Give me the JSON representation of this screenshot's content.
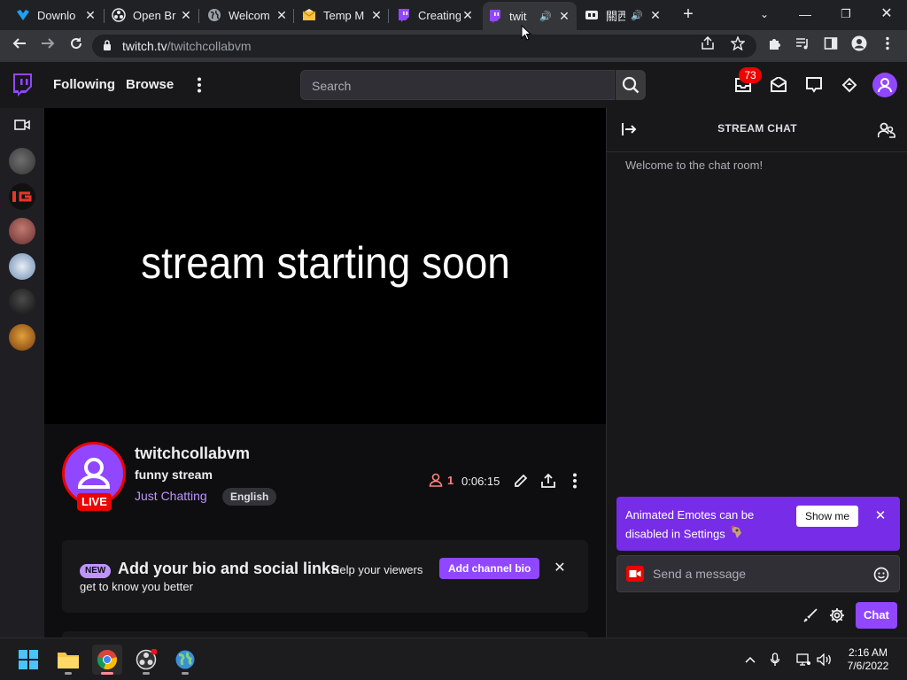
{
  "browser": {
    "tabs": [
      {
        "title": "Downlo",
        "icon": "blue-bird-icon"
      },
      {
        "title": "Open Br",
        "icon": "open-broadcaster-icon"
      },
      {
        "title": "Welcom",
        "icon": "globe-icon"
      },
      {
        "title": "Temp M",
        "icon": "envelope-icon"
      },
      {
        "title": "Creating",
        "icon": "twitch-icon"
      },
      {
        "title": "twit",
        "icon": "twitch-icon"
      },
      {
        "title": "關西",
        "icon": "media-icon"
      }
    ],
    "address": {
      "host": "twitch.tv",
      "path": "/twitchcollabvm"
    }
  },
  "twitch": {
    "nav": {
      "following": "Following",
      "browse": "Browse",
      "search_placeholder": "Search",
      "notification_count": "73"
    },
    "channel": {
      "name": "twitchcollabvm",
      "stream_title": "funny stream",
      "category": "Just Chatting",
      "language_tag": "English",
      "live_label": "LIVE",
      "viewer_count": "1",
      "uptime": "0:06:15"
    },
    "player": {
      "slate_text": "stream starting soon"
    },
    "bio_card": {
      "new_label": "NEW",
      "heading": "Add your bio and social links",
      "sub_line1": "Help your viewers",
      "sub_line2": "get to know you better",
      "button": "Add channel bio"
    },
    "chat": {
      "title": "STREAM CHAT",
      "welcome": "Welcome to the chat room!",
      "promo_text": "Animated Emotes can be disabled in Settings",
      "promo_button": "Show me",
      "input_placeholder": "Send a message",
      "send_button": "Chat"
    },
    "colors": {
      "brand": "#9147ff",
      "live": "#eb0400",
      "promo": "#772ce8"
    }
  },
  "taskbar": {
    "time": "2:16 AM",
    "date": "7/6/2022"
  }
}
